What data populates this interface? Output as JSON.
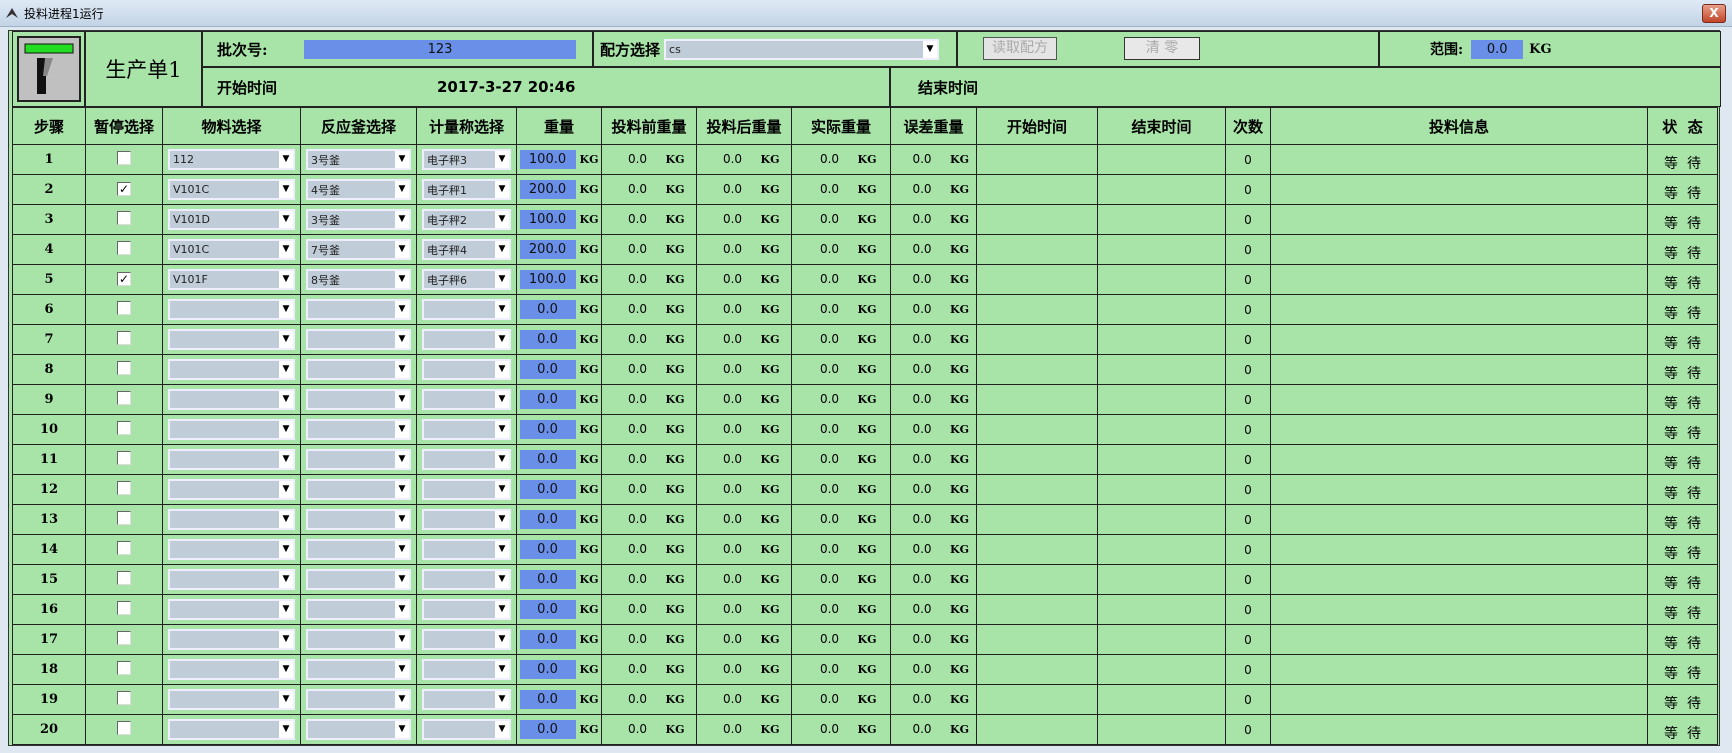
{
  "window": {
    "title": "投料进程1运行",
    "close": "X"
  },
  "header": {
    "order_name": "生产单1",
    "batch_label": "批次号:",
    "batch_value": "123",
    "recipe_label": "配方选择",
    "recipe_value": "cs",
    "read_recipe": "读取配方",
    "clear": "清 零",
    "range_label": "范围:",
    "range_value": "0.0",
    "range_unit": "KG",
    "start_label": "开始时间",
    "start_value": "2017-3-27 20:46",
    "end_label": "结束时间"
  },
  "columns": [
    "步骤",
    "暂停选择",
    "物料选择",
    "反应釜选择",
    "计量称选择",
    "重量",
    "投料前重量",
    "投料后重量",
    "实际重量",
    "误差重量",
    "开始时间",
    "结束时间",
    "次数",
    "投料信息",
    "状  态"
  ],
  "unit": "KG",
  "rows": [
    {
      "step": "1",
      "paused": false,
      "material": "112",
      "reactor": "3号釜",
      "scale": "电子秤3",
      "weight": "100.0",
      "before": "0.0",
      "after": "0.0",
      "actual": "0.0",
      "error": "0.0",
      "start": "",
      "end": "",
      "count": "0",
      "info": "",
      "status": "等  待"
    },
    {
      "step": "2",
      "paused": true,
      "material": "V101C",
      "reactor": "4号釜",
      "scale": "电子秤1",
      "weight": "200.0",
      "before": "0.0",
      "after": "0.0",
      "actual": "0.0",
      "error": "0.0",
      "start": "",
      "end": "",
      "count": "0",
      "info": "",
      "status": "等  待"
    },
    {
      "step": "3",
      "paused": false,
      "material": "V101D",
      "reactor": "3号釜",
      "scale": "电子秤2",
      "weight": "100.0",
      "before": "0.0",
      "after": "0.0",
      "actual": "0.0",
      "error": "0.0",
      "start": "",
      "end": "",
      "count": "0",
      "info": "",
      "status": "等  待"
    },
    {
      "step": "4",
      "paused": false,
      "material": "V101C",
      "reactor": "7号釜",
      "scale": "电子秤4",
      "weight": "200.0",
      "before": "0.0",
      "after": "0.0",
      "actual": "0.0",
      "error": "0.0",
      "start": "",
      "end": "",
      "count": "0",
      "info": "",
      "status": "等  待"
    },
    {
      "step": "5",
      "paused": true,
      "material": "V101F",
      "reactor": "8号釜",
      "scale": "电子秤6",
      "weight": "100.0",
      "before": "0.0",
      "after": "0.0",
      "actual": "0.0",
      "error": "0.0",
      "start": "",
      "end": "",
      "count": "0",
      "info": "",
      "status": "等  待"
    },
    {
      "step": "6",
      "paused": false,
      "material": "",
      "reactor": "",
      "scale": "",
      "weight": "0.0",
      "before": "0.0",
      "after": "0.0",
      "actual": "0.0",
      "error": "0.0",
      "start": "",
      "end": "",
      "count": "0",
      "info": "",
      "status": "等  待"
    },
    {
      "step": "7",
      "paused": false,
      "material": "",
      "reactor": "",
      "scale": "",
      "weight": "0.0",
      "before": "0.0",
      "after": "0.0",
      "actual": "0.0",
      "error": "0.0",
      "start": "",
      "end": "",
      "count": "0",
      "info": "",
      "status": "等  待"
    },
    {
      "step": "8",
      "paused": false,
      "material": "",
      "reactor": "",
      "scale": "",
      "weight": "0.0",
      "before": "0.0",
      "after": "0.0",
      "actual": "0.0",
      "error": "0.0",
      "start": "",
      "end": "",
      "count": "0",
      "info": "",
      "status": "等  待"
    },
    {
      "step": "9",
      "paused": false,
      "material": "",
      "reactor": "",
      "scale": "",
      "weight": "0.0",
      "before": "0.0",
      "after": "0.0",
      "actual": "0.0",
      "error": "0.0",
      "start": "",
      "end": "",
      "count": "0",
      "info": "",
      "status": "等  待"
    },
    {
      "step": "10",
      "paused": false,
      "material": "",
      "reactor": "",
      "scale": "",
      "weight": "0.0",
      "before": "0.0",
      "after": "0.0",
      "actual": "0.0",
      "error": "0.0",
      "start": "",
      "end": "",
      "count": "0",
      "info": "",
      "status": "等  待"
    },
    {
      "step": "11",
      "paused": false,
      "material": "",
      "reactor": "",
      "scale": "",
      "weight": "0.0",
      "before": "0.0",
      "after": "0.0",
      "actual": "0.0",
      "error": "0.0",
      "start": "",
      "end": "",
      "count": "0",
      "info": "",
      "status": "等  待"
    },
    {
      "step": "12",
      "paused": false,
      "material": "",
      "reactor": "",
      "scale": "",
      "weight": "0.0",
      "before": "0.0",
      "after": "0.0",
      "actual": "0.0",
      "error": "0.0",
      "start": "",
      "end": "",
      "count": "0",
      "info": "",
      "status": "等  待"
    },
    {
      "step": "13",
      "paused": false,
      "material": "",
      "reactor": "",
      "scale": "",
      "weight": "0.0",
      "before": "0.0",
      "after": "0.0",
      "actual": "0.0",
      "error": "0.0",
      "start": "",
      "end": "",
      "count": "0",
      "info": "",
      "status": "等  待"
    },
    {
      "step": "14",
      "paused": false,
      "material": "",
      "reactor": "",
      "scale": "",
      "weight": "0.0",
      "before": "0.0",
      "after": "0.0",
      "actual": "0.0",
      "error": "0.0",
      "start": "",
      "end": "",
      "count": "0",
      "info": "",
      "status": "等  待"
    },
    {
      "step": "15",
      "paused": false,
      "material": "",
      "reactor": "",
      "scale": "",
      "weight": "0.0",
      "before": "0.0",
      "after": "0.0",
      "actual": "0.0",
      "error": "0.0",
      "start": "",
      "end": "",
      "count": "0",
      "info": "",
      "status": "等  待"
    },
    {
      "step": "16",
      "paused": false,
      "material": "",
      "reactor": "",
      "scale": "",
      "weight": "0.0",
      "before": "0.0",
      "after": "0.0",
      "actual": "0.0",
      "error": "0.0",
      "start": "",
      "end": "",
      "count": "0",
      "info": "",
      "status": "等  待"
    },
    {
      "step": "17",
      "paused": false,
      "material": "",
      "reactor": "",
      "scale": "",
      "weight": "0.0",
      "before": "0.0",
      "after": "0.0",
      "actual": "0.0",
      "error": "0.0",
      "start": "",
      "end": "",
      "count": "0",
      "info": "",
      "status": "等  待"
    },
    {
      "step": "18",
      "paused": false,
      "material": "",
      "reactor": "",
      "scale": "",
      "weight": "0.0",
      "before": "0.0",
      "after": "0.0",
      "actual": "0.0",
      "error": "0.0",
      "start": "",
      "end": "",
      "count": "0",
      "info": "",
      "status": "等  待"
    },
    {
      "step": "19",
      "paused": false,
      "material": "",
      "reactor": "",
      "scale": "",
      "weight": "0.0",
      "before": "0.0",
      "after": "0.0",
      "actual": "0.0",
      "error": "0.0",
      "start": "",
      "end": "",
      "count": "0",
      "info": "",
      "status": "等  待"
    },
    {
      "step": "20",
      "paused": false,
      "material": "",
      "reactor": "",
      "scale": "",
      "weight": "0.0",
      "before": "0.0",
      "after": "0.0",
      "actual": "0.0",
      "error": "0.0",
      "start": "",
      "end": "",
      "count": "0",
      "info": "",
      "status": "等  待"
    }
  ]
}
